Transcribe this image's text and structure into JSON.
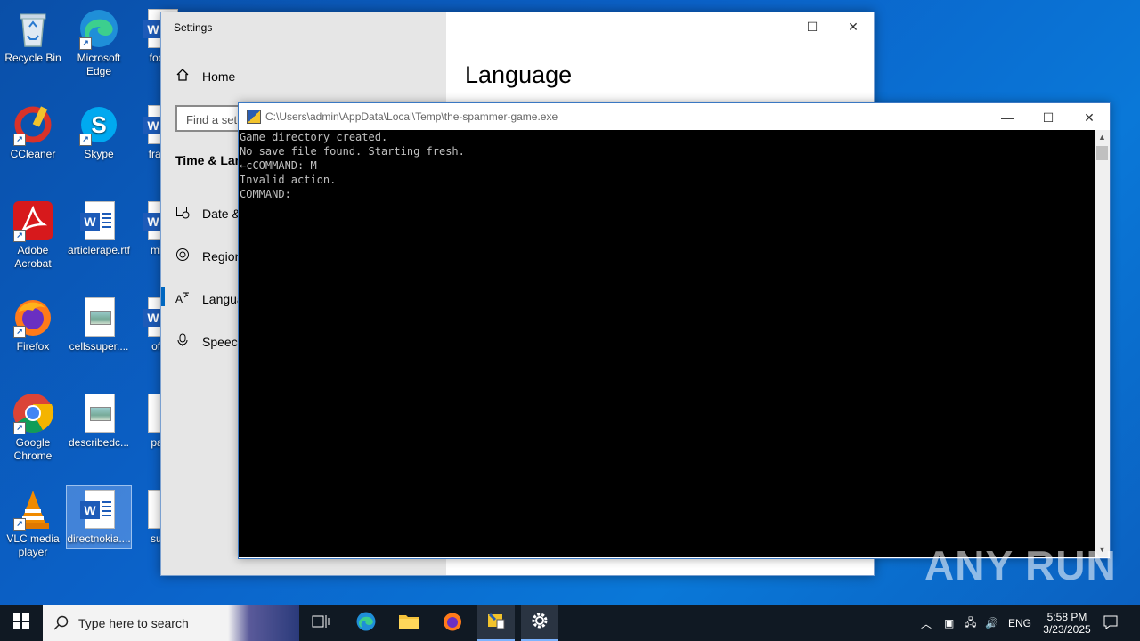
{
  "desktop": {
    "icons": [
      {
        "label": "Recycle Bin",
        "icon": "recycle-bin-icon"
      },
      {
        "label": "Microsoft Edge",
        "icon": "edge-icon"
      },
      {
        "label": "focus",
        "icon": "word-doc-icon"
      },
      {
        "label": "CCleaner",
        "icon": "ccleaner-icon"
      },
      {
        "label": "Skype",
        "icon": "skype-icon"
      },
      {
        "label": "frame",
        "icon": "word-doc-icon"
      },
      {
        "label": "Adobe Acrobat",
        "icon": "acrobat-icon"
      },
      {
        "label": "articlerape.rtf",
        "icon": "word-doc-icon"
      },
      {
        "label": "minu",
        "icon": "word-doc-icon"
      },
      {
        "label": "Firefox",
        "icon": "firefox-icon"
      },
      {
        "label": "cellssuper....",
        "icon": "image-doc-icon"
      },
      {
        "label": "offer",
        "icon": "word-doc-icon"
      },
      {
        "label": "Google Chrome",
        "icon": "chrome-icon"
      },
      {
        "label": "describedc...",
        "icon": "image-doc-icon"
      },
      {
        "label": "pack",
        "icon": "doc-icon"
      },
      {
        "label": "VLC media player",
        "icon": "vlc-icon"
      },
      {
        "label": "directnokia....",
        "icon": "word-doc-icon"
      },
      {
        "label": "subn",
        "icon": "doc-icon"
      }
    ]
  },
  "settings": {
    "window_title": "Settings",
    "home": "Home",
    "search_placeholder": "Find a set",
    "section": "Time & Lan",
    "nav": [
      "Date &",
      "Region",
      "Langua",
      "Speech"
    ],
    "page_title": "Language"
  },
  "console": {
    "title": "C:\\Users\\admin\\AppData\\Local\\Temp\\the-spammer-game.exe",
    "output": "Game directory created.\nNo save file found. Starting fresh.\n←cCOMMAND: M\nInvalid action.\nCOMMAND:"
  },
  "watermark": "ANY RUN",
  "taskbar": {
    "search_placeholder": "Type here to search",
    "language": "ENG",
    "time": "5:58 PM",
    "date": "3/23/2025"
  }
}
